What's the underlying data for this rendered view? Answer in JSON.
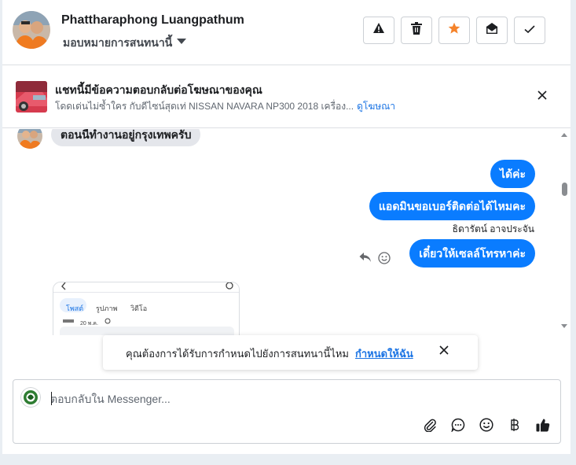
{
  "header": {
    "contact_name": "Phattharaphong Luangpathum",
    "assign_label": "มอบหมายการสนทนานี้",
    "buttons": [
      "alert-icon",
      "trash-icon",
      "star-icon",
      "mark-unread-icon",
      "check-icon"
    ],
    "colors": {
      "star": "#f5832b"
    }
  },
  "banner": {
    "title": "แชทนี้มีข้อความตอบกลับต่อโฆษณาของคุณ",
    "subtitle": "โดดเด่นไม่ซ้ำใคร กับดีไซน์สุดเท่ NISSAN NAVARA NP300 2018 เครื่อง...",
    "link": "ดูโฆษณา"
  },
  "messages": {
    "incoming_1": "ตอนนี้ทำงานอยู่กรุงเทพครับ",
    "outgoing_1": "ได้ค่ะ",
    "outgoing_2": "แอดมินขอเบอร์ติดต่อได้ไหมคะ",
    "sender_name": "ธิดารัตน์ อาจประจัน",
    "outgoing_3": "เดี๋ยวให้เซลล์โทรหาค่ะ",
    "outgoing_color": "#0a7cff"
  },
  "preview": {
    "tabs": [
      "โพสต์",
      "รูปภาพ",
      "วิดีโอ"
    ],
    "date": "20 พ.ค."
  },
  "toast": {
    "text": "คุณต้องการได้รับการกำหนดไปยังการสนทนานี้ไหม",
    "link": "กำหนดให้ฉัน"
  },
  "composer": {
    "placeholder": "ตอบกลับใน Messenger...",
    "value": "",
    "tools": [
      "attachment-icon",
      "saved-reply-icon",
      "emoji-icon",
      "baht-icon",
      "thumbs-up-icon"
    ]
  }
}
